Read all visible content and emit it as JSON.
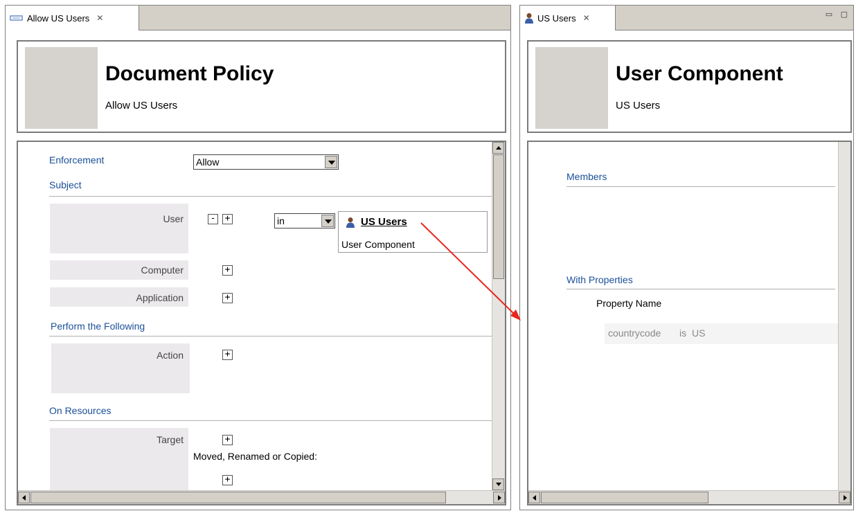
{
  "left_editor": {
    "tab": {
      "title": "Allow US Users",
      "icon": "policy-icon",
      "close": "✕"
    },
    "header": {
      "title": "Document Policy",
      "subtitle": "Allow US Users"
    },
    "enforcement": {
      "label": "Enforcement",
      "value": "Allow"
    },
    "subject": {
      "label": "Subject",
      "user": {
        "label": "User",
        "operator": "in",
        "component": {
          "name": "US Users",
          "type": "User Component"
        }
      },
      "computer": {
        "label": "Computer"
      },
      "application": {
        "label": "Application"
      }
    },
    "perform": {
      "label": "Perform the Following",
      "action": {
        "label": "Action"
      }
    },
    "resources": {
      "label": "On Resources",
      "target": {
        "label": "Target"
      },
      "moved_label": "Moved, Renamed or Copied:"
    },
    "minus_glyph": "-",
    "plus_glyph": "+"
  },
  "right_editor": {
    "tab": {
      "title": "US Users",
      "icon": "user-icon",
      "close": "✕"
    },
    "header": {
      "title": "User Component",
      "subtitle": "US Users"
    },
    "members": {
      "label": "Members"
    },
    "with_properties": {
      "label": "With Properties",
      "column_header": "Property Name",
      "row": {
        "name": "countrycode",
        "operator": "is",
        "value": "US"
      }
    },
    "view_controls": "▭ ▢"
  },
  "colors": {
    "section_link": "#1a4f9a",
    "arrow": "#e8261e",
    "gray_box": "#ece9ec"
  }
}
